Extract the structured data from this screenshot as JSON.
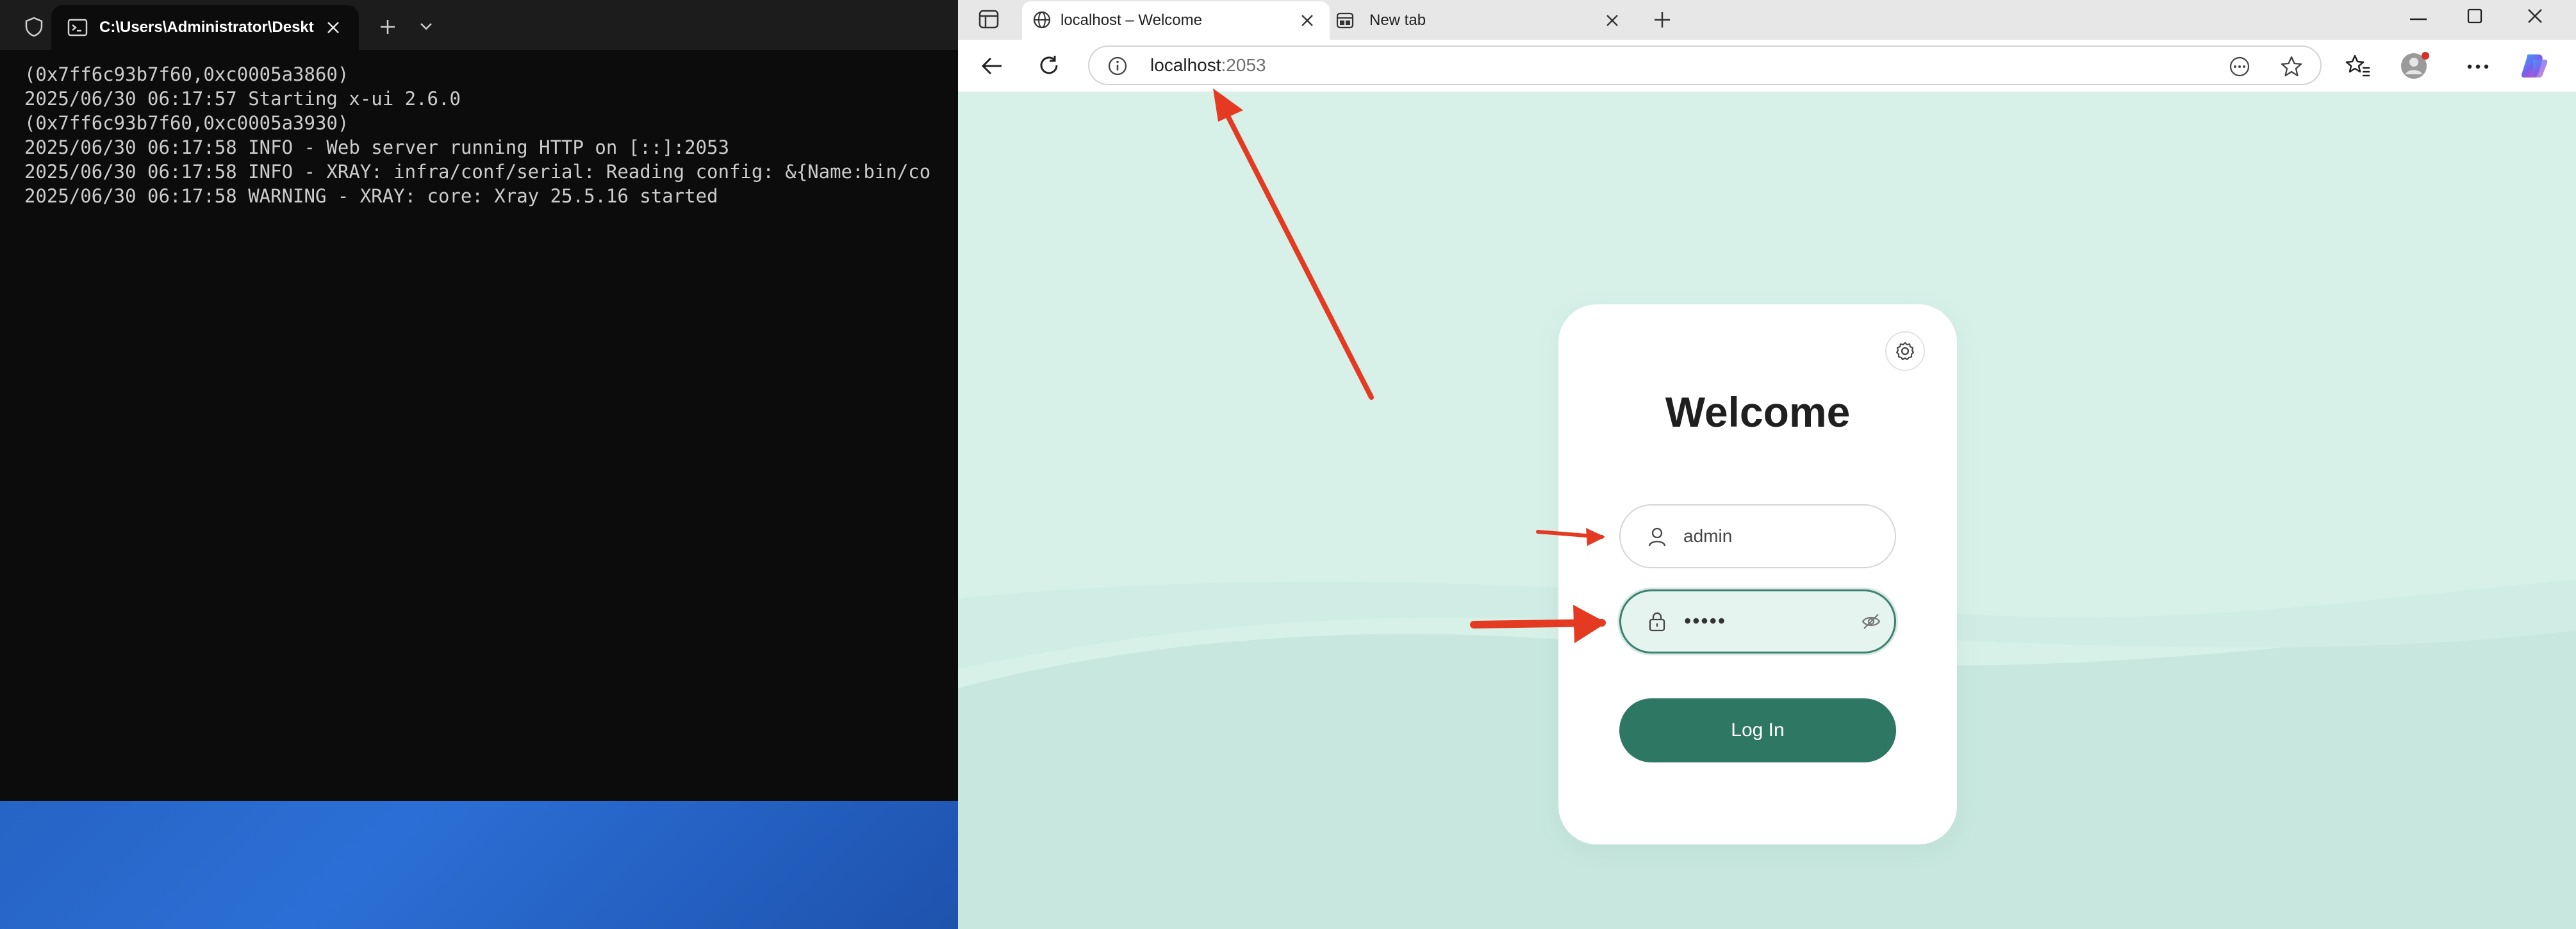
{
  "terminal": {
    "tab_title": "C:\\Users\\Administrator\\Deskt",
    "lines": [
      "(0x7ff6c93b7f60,0xc0005a3860)",
      "2025/06/30 06:17:57 Starting x-ui 2.6.0",
      "(0x7ff6c93b7f60,0xc0005a3930)",
      "2025/06/30 06:17:58 INFO - Web server running HTTP on [::]:2053",
      "2025/06/30 06:17:58 INFO - XRAY: infra/conf/serial: Reading config: &{Name:bin/co",
      "2025/06/30 06:17:58 WARNING - XRAY: core: Xray 25.5.16 started"
    ]
  },
  "browser": {
    "tabs": [
      {
        "title": "localhost – Welcome",
        "active": true
      },
      {
        "title": "New tab",
        "active": false
      }
    ],
    "address": {
      "host": "localhost",
      "port": ":2053"
    }
  },
  "login": {
    "title": "Welcome",
    "username_value": "admin",
    "password_value": "•••••",
    "login_label": "Log In"
  },
  "colors": {
    "accent": "#2e7763",
    "page_background": "#d7f1e9",
    "annotation_arrow": "#e53a22"
  },
  "icons": [
    "shield-icon",
    "terminal-icon",
    "close-icon",
    "plus-icon",
    "chevron-down-icon",
    "sidebar-icon",
    "globe-icon",
    "newtab-icon",
    "minimize-icon",
    "maximize-icon",
    "back-icon",
    "refresh-icon",
    "info-icon",
    "more-icon",
    "star-icon",
    "favorites-icon",
    "profile-icon",
    "copilot-icon",
    "gear-icon",
    "user-icon",
    "lock-icon",
    "eye-off-icon"
  ]
}
